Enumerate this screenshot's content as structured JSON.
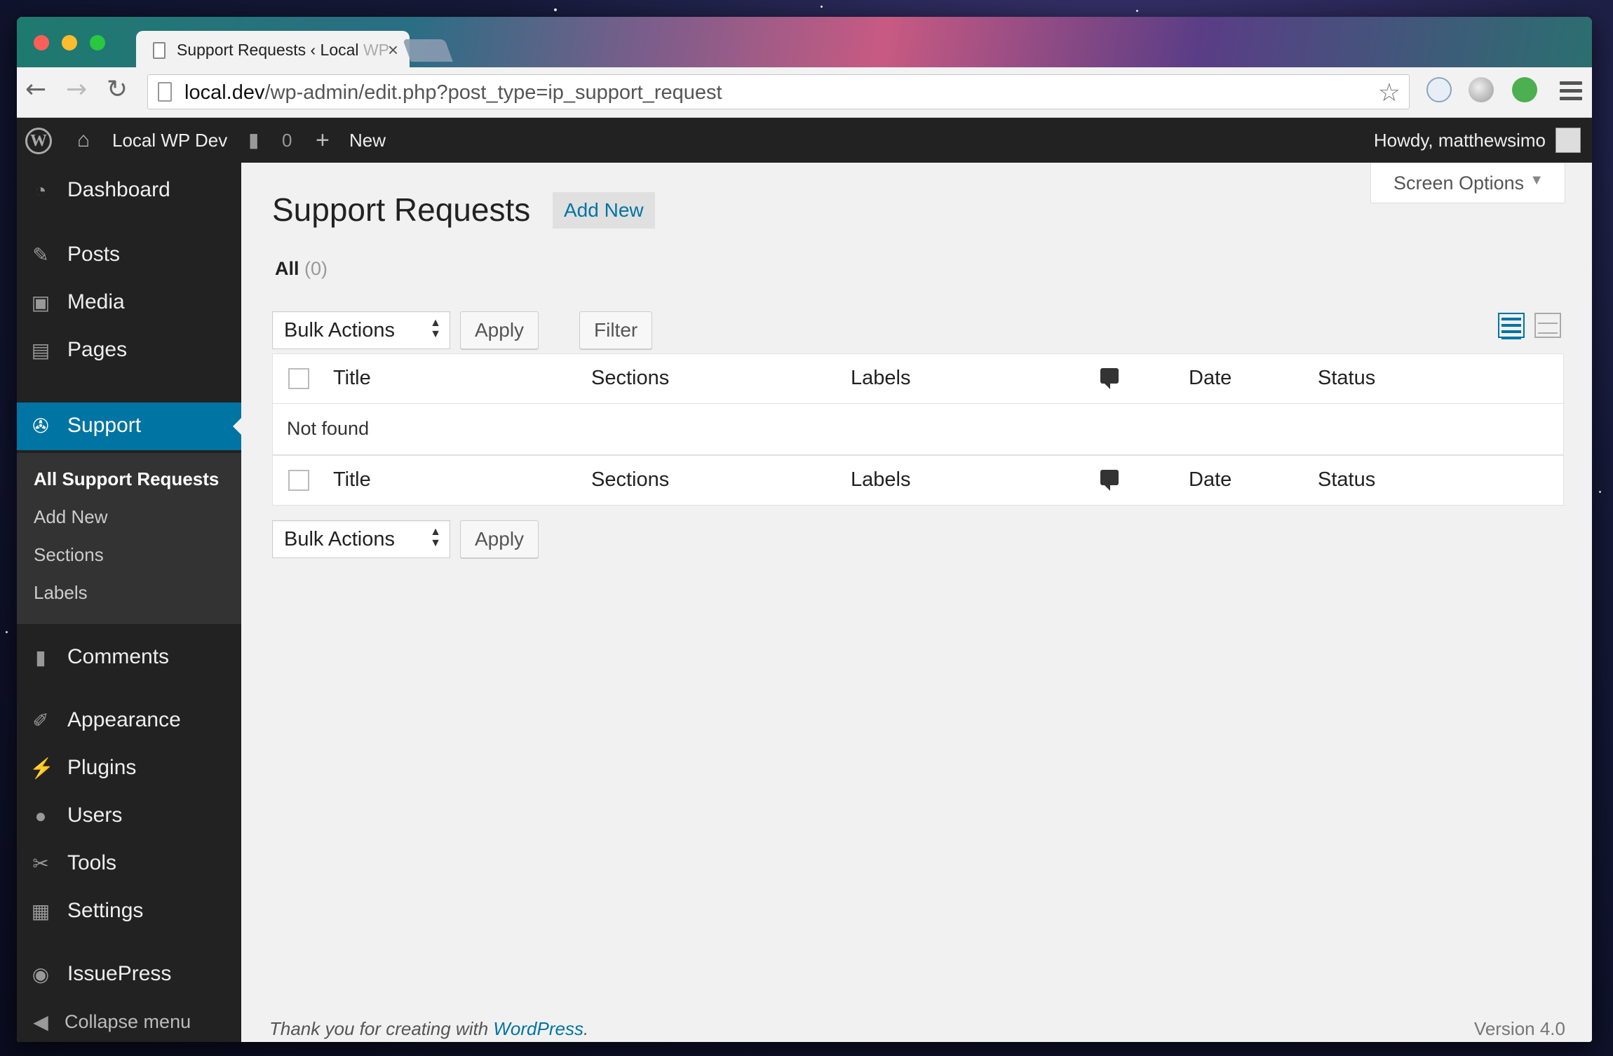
{
  "browser": {
    "tab_title": "Support Requests ‹ Local ",
    "tab_title_faded": "WP",
    "tab_close": "×",
    "url_host": "local.dev",
    "url_path": "/wp-admin/edit.php?post_type=ip_support_request"
  },
  "adminbar": {
    "site_name": "Local WP Dev",
    "comments_count": "0",
    "new_label": "New",
    "howdy": "Howdy, matthewsimo"
  },
  "sidebar": {
    "items": [
      {
        "label": "Dashboard",
        "icon": "dashboard-icon"
      },
      {
        "label": "Posts",
        "icon": "pin-icon"
      },
      {
        "label": "Media",
        "icon": "media-icon"
      },
      {
        "label": "Pages",
        "icon": "pages-icon"
      },
      {
        "label": "Support",
        "icon": "lifebuoy-icon"
      },
      {
        "label": "Comments",
        "icon": "comment-icon"
      },
      {
        "label": "Appearance",
        "icon": "brush-icon"
      },
      {
        "label": "Plugins",
        "icon": "plug-icon"
      },
      {
        "label": "Users",
        "icon": "user-icon"
      },
      {
        "label": "Tools",
        "icon": "wrench-icon"
      },
      {
        "label": "Settings",
        "icon": "sliders-icon"
      },
      {
        "label": "IssuePress",
        "icon": "issuepress-icon"
      },
      {
        "label": "Collapse menu",
        "icon": "collapse-icon"
      }
    ],
    "submenu": [
      "All Support Requests",
      "Add New",
      "Sections",
      "Labels"
    ]
  },
  "main": {
    "screen_options": "Screen Options",
    "title": "Support Requests",
    "add_new": "Add New",
    "views_all": "All",
    "views_count": "(0)",
    "bulk_actions": "Bulk Actions",
    "apply": "Apply",
    "filter": "Filter",
    "columns": [
      "Title",
      "Sections",
      "Labels",
      "Date",
      "Status"
    ],
    "empty_message": "Not found"
  },
  "footer": {
    "thanks": "Thank you for creating with ",
    "wp_link": "WordPress",
    "period": ".",
    "version": "Version 4.0"
  },
  "colors": {
    "accent": "#0074a2",
    "sidebar_bg": "#222222",
    "submenu_bg": "#333333",
    "content_bg": "#f1f1f1"
  }
}
